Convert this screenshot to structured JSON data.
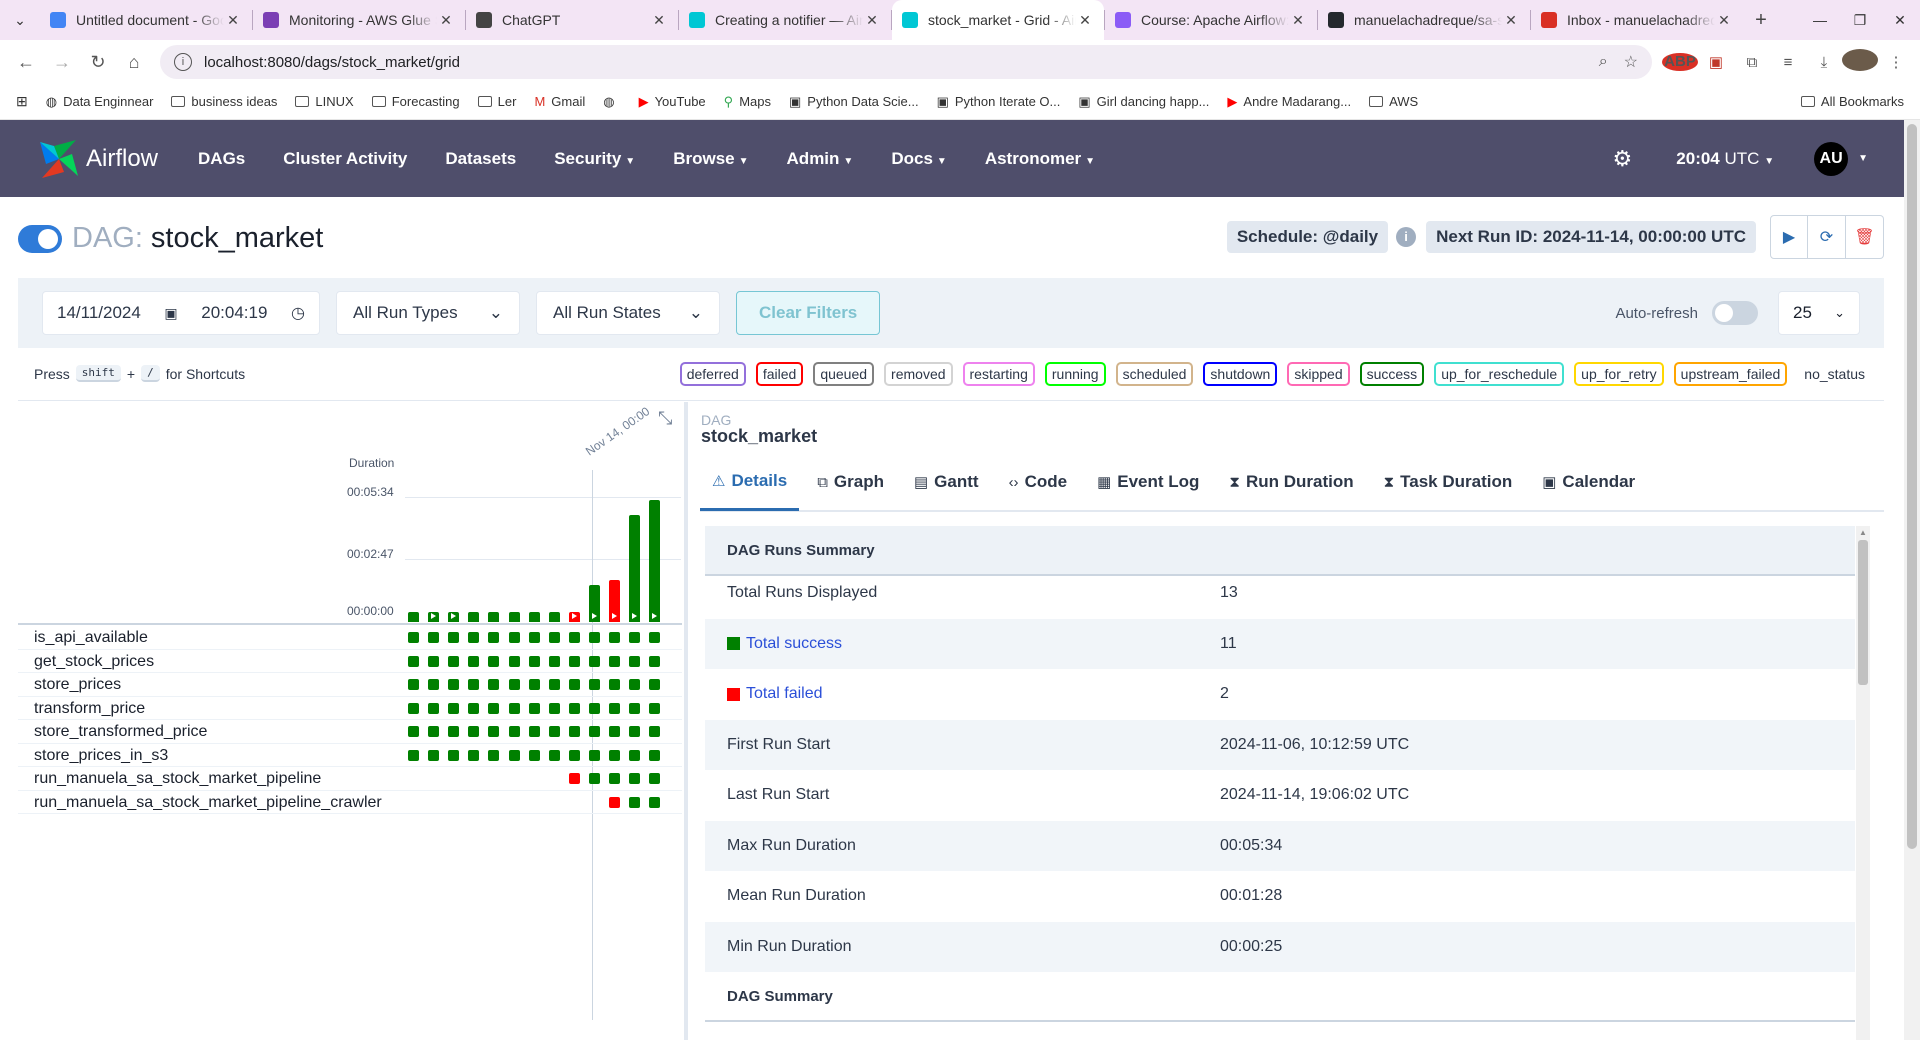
{
  "browser": {
    "tabs": [
      {
        "title": "Untitled document - Goo",
        "icon": "docs-icon",
        "color": "#4285f4",
        "active": false
      },
      {
        "title": "Monitoring - AWS Glue St",
        "icon": "glue-icon",
        "color": "#7b3fb4",
        "active": false
      },
      {
        "title": "ChatGPT",
        "icon": "chatgpt-icon",
        "color": "#444444",
        "active": false
      },
      {
        "title": "Creating a notifier — Air",
        "icon": "airflow-icon",
        "color": "#00c7d4",
        "active": false
      },
      {
        "title": "stock_market - Grid - Air",
        "icon": "airflow-icon",
        "color": "#00c7d4",
        "active": true
      },
      {
        "title": "Course: Apache Airflow: T",
        "icon": "course-icon",
        "color": "#8b5cf6",
        "active": false
      },
      {
        "title": "manuelachadreque/sa-st",
        "icon": "github-icon",
        "color": "#24292e",
        "active": false
      },
      {
        "title": "Inbox - manuelachadreq",
        "icon": "gmail-icon",
        "color": "#d93025",
        "active": false
      }
    ],
    "url": "localhost:8080/dags/stock_market/grid",
    "bookmarks": [
      {
        "label": "Data Enginnear",
        "icon": "globe-icon"
      },
      {
        "label": "business ideas",
        "icon": "folder-icon"
      },
      {
        "label": "LINUX",
        "icon": "folder-icon"
      },
      {
        "label": "Forecasting",
        "icon": "folder-icon"
      },
      {
        "label": "Ler",
        "icon": "folder-icon"
      },
      {
        "label": "Gmail",
        "icon": "gmail-icon"
      },
      {
        "label": "",
        "icon": "globe-icon"
      },
      {
        "label": "YouTube",
        "icon": "youtube-icon"
      },
      {
        "label": "Maps",
        "icon": "maps-icon"
      },
      {
        "label": "Python Data Scie...",
        "icon": "page-icon"
      },
      {
        "label": "Python Iterate O...",
        "icon": "page-icon"
      },
      {
        "label": "Girl dancing happ...",
        "icon": "page-icon"
      },
      {
        "label": "Andre Madarang...",
        "icon": "youtube-icon"
      },
      {
        "label": "AWS",
        "icon": "folder-icon"
      }
    ],
    "all_bookmarks": "All Bookmarks"
  },
  "nav": {
    "brand": "Airflow",
    "items": [
      {
        "label": "DAGs",
        "dropdown": false
      },
      {
        "label": "Cluster Activity",
        "dropdown": false
      },
      {
        "label": "Datasets",
        "dropdown": false
      },
      {
        "label": "Security",
        "dropdown": true
      },
      {
        "label": "Browse",
        "dropdown": true
      },
      {
        "label": "Admin",
        "dropdown": true
      },
      {
        "label": "Docs",
        "dropdown": true
      },
      {
        "label": "Astronomer",
        "dropdown": true
      }
    ],
    "time": "20:04",
    "tz": "UTC",
    "user_initials": "AU"
  },
  "dag": {
    "prefix": "DAG:",
    "name": "stock_market",
    "schedule": "Schedule: @daily",
    "next_run": "Next Run ID: 2024-11-14, 00:00:00 UTC"
  },
  "filters": {
    "date": "14/11/2024",
    "time": "20:04:19",
    "run_types": "All Run Types",
    "run_states": "All Run States",
    "clear": "Clear Filters",
    "autorefresh": "Auto-refresh",
    "page_size": "25"
  },
  "shortcuts": {
    "press": "Press",
    "key1": "shift",
    "plus": "+",
    "key2": "/",
    "suffix": "for Shortcuts"
  },
  "legend": [
    {
      "label": "deferred",
      "color": "#9370db"
    },
    {
      "label": "failed",
      "color": "#ff0000"
    },
    {
      "label": "queued",
      "color": "#808080"
    },
    {
      "label": "removed",
      "color": "#d3d3d3"
    },
    {
      "label": "restarting",
      "color": "#ee82ee"
    },
    {
      "label": "running",
      "color": "#00ff00"
    },
    {
      "label": "scheduled",
      "color": "#d2b48c"
    },
    {
      "label": "shutdown",
      "color": "#0000ff"
    },
    {
      "label": "skipped",
      "color": "#ff69b4"
    },
    {
      "label": "success",
      "color": "#008000"
    },
    {
      "label": "up_for_reschedule",
      "color": "#40e0d0"
    },
    {
      "label": "up_for_retry",
      "color": "#ffd700"
    },
    {
      "label": "upstream_failed",
      "color": "#ffa500"
    },
    {
      "label": "no_status",
      "color": ""
    }
  ],
  "grid": {
    "duration_label": "Duration",
    "yticks": [
      "00:05:34",
      "00:02:47",
      "00:00:00"
    ],
    "date_label": "Nov 14, 00:00",
    "runs": [
      {
        "state": "success",
        "duration_frac": 0.08,
        "manual": false
      },
      {
        "state": "success",
        "duration_frac": 0.08,
        "manual": true
      },
      {
        "state": "success",
        "duration_frac": 0.08,
        "manual": true
      },
      {
        "state": "success",
        "duration_frac": 0.08,
        "manual": false
      },
      {
        "state": "success",
        "duration_frac": 0.08,
        "manual": false
      },
      {
        "state": "success",
        "duration_frac": 0.08,
        "manual": false
      },
      {
        "state": "success",
        "duration_frac": 0.08,
        "manual": false
      },
      {
        "state": "success",
        "duration_frac": 0.08,
        "manual": false
      },
      {
        "state": "failed",
        "duration_frac": 0.08,
        "manual": true
      },
      {
        "state": "success",
        "duration_frac": 0.3,
        "manual": true
      },
      {
        "state": "failed",
        "duration_frac": 0.34,
        "manual": true
      },
      {
        "state": "success",
        "duration_frac": 0.86,
        "manual": true
      },
      {
        "state": "success",
        "duration_frac": 0.98,
        "manual": true
      }
    ],
    "tasks": [
      {
        "name": "is_api_available",
        "states": [
          "success",
          "success",
          "success",
          "success",
          "success",
          "success",
          "success",
          "success",
          "success",
          "success",
          "success",
          "success",
          "success"
        ]
      },
      {
        "name": "get_stock_prices",
        "states": [
          "success",
          "success",
          "success",
          "success",
          "success",
          "success",
          "success",
          "success",
          "success",
          "success",
          "success",
          "success",
          "success"
        ]
      },
      {
        "name": "store_prices",
        "states": [
          "success",
          "success",
          "success",
          "success",
          "success",
          "success",
          "success",
          "success",
          "success",
          "success",
          "success",
          "success",
          "success"
        ]
      },
      {
        "name": "transform_price",
        "states": [
          "success",
          "success",
          "success",
          "success",
          "success",
          "success",
          "success",
          "success",
          "success",
          "success",
          "success",
          "success",
          "success"
        ]
      },
      {
        "name": "store_transformed_price",
        "states": [
          "success",
          "success",
          "success",
          "success",
          "success",
          "success",
          "success",
          "success",
          "success",
          "success",
          "success",
          "success",
          "success"
        ]
      },
      {
        "name": "store_prices_in_s3",
        "states": [
          "success",
          "success",
          "success",
          "success",
          "success",
          "success",
          "success",
          "success",
          "success",
          "success",
          "success",
          "success",
          "success"
        ]
      },
      {
        "name": "run_manuela_sa_stock_market_pipeline",
        "states": [
          "",
          "",
          "",
          "",
          "",
          "",
          "",
          "",
          "failed",
          "success",
          "success",
          "success",
          "success"
        ]
      },
      {
        "name": "run_manuela_sa_stock_market_pipeline_crawler",
        "states": [
          "",
          "",
          "",
          "",
          "",
          "",
          "",
          "",
          "",
          "",
          "failed",
          "success",
          "success"
        ]
      }
    ]
  },
  "details": {
    "caption": "DAG",
    "title": "stock_market",
    "tabs": [
      {
        "label": "Details",
        "icon": "warning-triangle-icon",
        "glyph": "⚠",
        "active": true
      },
      {
        "label": "Graph",
        "icon": "graph-icon",
        "glyph": "⧉",
        "active": false
      },
      {
        "label": "Gantt",
        "icon": "gantt-icon",
        "glyph": "▤",
        "active": false
      },
      {
        "label": "Code",
        "icon": "code-icon",
        "glyph": "‹›",
        "active": false
      },
      {
        "label": "Event Log",
        "icon": "event-log-icon",
        "glyph": "▦",
        "active": false
      },
      {
        "label": "Run Duration",
        "icon": "hourglass-icon",
        "glyph": "⧗",
        "active": false
      },
      {
        "label": "Task Duration",
        "icon": "hourglass-icon",
        "glyph": "⧗",
        "active": false
      },
      {
        "label": "Calendar",
        "icon": "calendar-icon",
        "glyph": "▣",
        "active": false
      }
    ],
    "summary_head": "DAG Runs Summary",
    "rows": [
      {
        "key": "Total Runs Displayed",
        "value": "13",
        "color": "",
        "link": false
      },
      {
        "key": "Total success",
        "value": "11",
        "color": "#008000",
        "link": true
      },
      {
        "key": "Total failed",
        "value": "2",
        "color": "#ff0000",
        "link": true
      },
      {
        "key": "First Run Start",
        "value": "2024-11-06, 10:12:59 UTC",
        "color": "",
        "link": false
      },
      {
        "key": "Last Run Start",
        "value": "2024-11-14, 19:06:02 UTC",
        "color": "",
        "link": false
      },
      {
        "key": "Max Run Duration",
        "value": "00:05:34",
        "color": "",
        "link": false
      },
      {
        "key": "Mean Run Duration",
        "value": "00:01:28",
        "color": "",
        "link": false
      },
      {
        "key": "Min Run Duration",
        "value": "00:00:25",
        "color": "",
        "link": false
      }
    ],
    "dag_summary_head": "DAG Summary"
  }
}
